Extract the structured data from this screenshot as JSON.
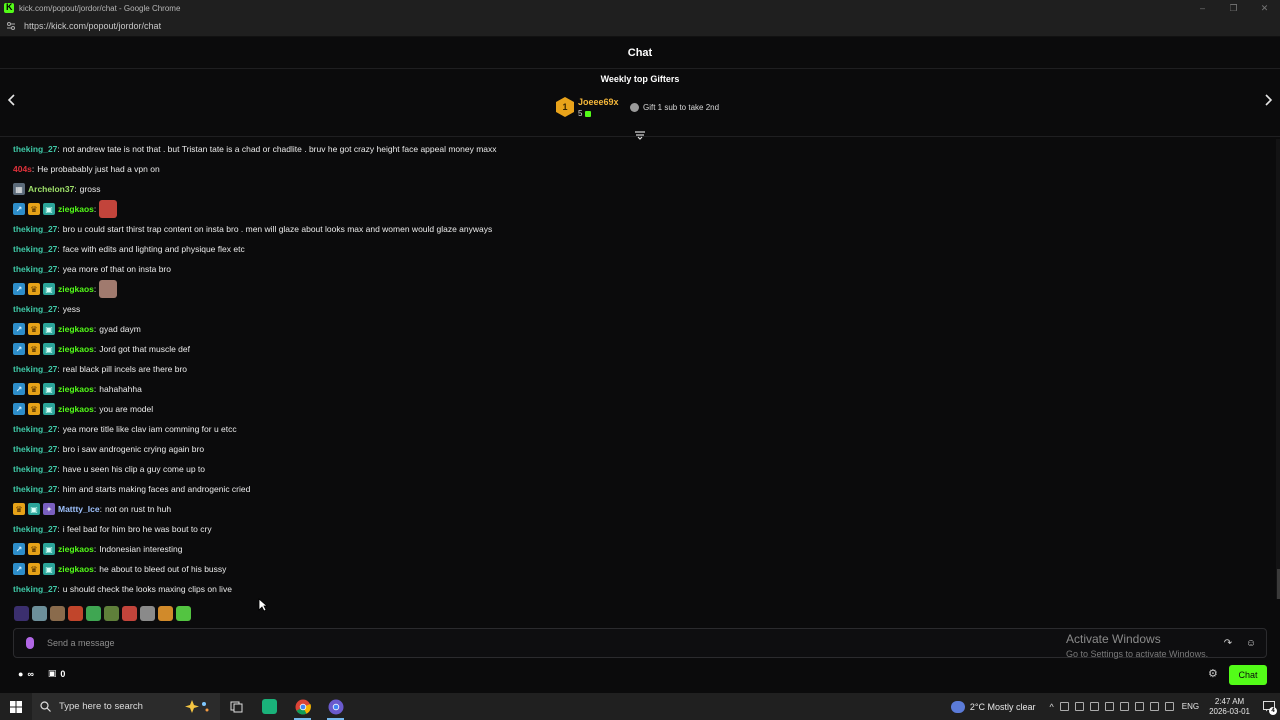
{
  "window": {
    "title": "kick.com/popout/jordor/chat - Google Chrome",
    "url": "https://kick.com/popout/jordor/chat"
  },
  "chat": {
    "header": "Chat",
    "gifters": {
      "label": "Weekly top Gifters",
      "top": {
        "rank": "1",
        "name": "Joeee69x",
        "count": "5"
      },
      "hint": "Gift 1 sub to take 2nd"
    },
    "colors": {
      "green": "#53fc18",
      "teal": "#3fc9a7",
      "red": "#e0313b",
      "gold": "#f3b63a"
    },
    "messages": [
      {
        "user": "theking_27",
        "color": "#3fc9a7",
        "badges": [],
        "text": "not andrew tate is not that . but Tristan tate is a chad or chadlite . bruv he got crazy height face appeal money maxx"
      },
      {
        "user": "404s",
        "color": "#e0313b",
        "badges": [],
        "text": "He probabably just had a vpn on"
      },
      {
        "user": "Archelon37",
        "color": "#9ee06a",
        "badges": [
          "grey"
        ],
        "text": "gross"
      },
      {
        "user": "ziegkaos",
        "color": "#53fc18",
        "badges": [
          "blue",
          "gold",
          "teal"
        ],
        "text": "",
        "emote": "#c2443b"
      },
      {
        "user": "theking_27",
        "color": "#3fc9a7",
        "badges": [],
        "text": "bro u could start thirst trap content on insta bro . men will glaze about looks max and women would glaze anyways"
      },
      {
        "user": "theking_27",
        "color": "#3fc9a7",
        "badges": [],
        "text": "face with edits and lighting and physique flex etc"
      },
      {
        "user": "theking_27",
        "color": "#3fc9a7",
        "badges": [],
        "text": "yea more of that on insta bro"
      },
      {
        "user": "ziegkaos",
        "color": "#53fc18",
        "badges": [
          "blue",
          "gold",
          "teal"
        ],
        "text": "",
        "emote": "#a07a6e"
      },
      {
        "user": "theking_27",
        "color": "#3fc9a7",
        "badges": [],
        "text": "yess"
      },
      {
        "user": "ziegkaos",
        "color": "#53fc18",
        "badges": [
          "blue",
          "gold",
          "teal"
        ],
        "text": "gyad daym"
      },
      {
        "user": "ziegkaos",
        "color": "#53fc18",
        "badges": [
          "blue",
          "gold",
          "teal"
        ],
        "text": "Jord got that muscle def"
      },
      {
        "user": "theking_27",
        "color": "#3fc9a7",
        "badges": [],
        "text": "real black pill incels are there bro"
      },
      {
        "user": "ziegkaos",
        "color": "#53fc18",
        "badges": [
          "blue",
          "gold",
          "teal"
        ],
        "text": "hahahahha"
      },
      {
        "user": "ziegkaos",
        "color": "#53fc18",
        "badges": [
          "blue",
          "gold",
          "teal"
        ],
        "text": "you are model"
      },
      {
        "user": "theking_27",
        "color": "#3fc9a7",
        "badges": [],
        "text": "yea more title like clav iam comming for u etcc"
      },
      {
        "user": "theking_27",
        "color": "#3fc9a7",
        "badges": [],
        "text": "bro i saw androgenic crying again bro"
      },
      {
        "user": "theking_27",
        "color": "#3fc9a7",
        "badges": [],
        "text": "have u seen his clip a guy come up to"
      },
      {
        "user": "theking_27",
        "color": "#3fc9a7",
        "badges": [],
        "text": "him and starts making faces and androgenic cried"
      },
      {
        "user": "Mattty_Ice",
        "color": "#9fc3ff",
        "badges": [
          "gold",
          "teal",
          "purple"
        ],
        "text": "not on rust tn huh"
      },
      {
        "user": "theking_27",
        "color": "#3fc9a7",
        "badges": [],
        "text": "i feel bad for him bro he was bout to cry"
      },
      {
        "user": "ziegkaos",
        "color": "#53fc18",
        "badges": [
          "blue",
          "gold",
          "teal"
        ],
        "text": "Indonesian interesting"
      },
      {
        "user": "ziegkaos",
        "color": "#53fc18",
        "badges": [
          "blue",
          "gold",
          "teal"
        ],
        "text": "he about to bleed out of his bussy"
      },
      {
        "user": "theking_27",
        "color": "#3fc9a7",
        "badges": [],
        "text": "u should check the looks maxing clips on live"
      }
    ],
    "emote_bar": [
      "#3b2f6e",
      "#6c8f9a",
      "#8a6b4c",
      "#c1452b",
      "#3fa652",
      "#5f7f3a",
      "#c2443b",
      "#8a8a8a",
      "#d18a2a",
      "#53c441"
    ],
    "input": {
      "placeholder": "Send a message",
      "value": ""
    },
    "footer": {
      "count_a": "0",
      "send_label": "Chat"
    }
  },
  "watermark": {
    "line1": "Activate Windows",
    "line2": "Go to Settings to activate Windows."
  },
  "taskbar": {
    "search_placeholder": "Type here to search",
    "weather": "2°C  Mostly clear",
    "lang": "ENG",
    "time": "2:47 AM",
    "date": "2026-03-01",
    "notifications": "4"
  }
}
